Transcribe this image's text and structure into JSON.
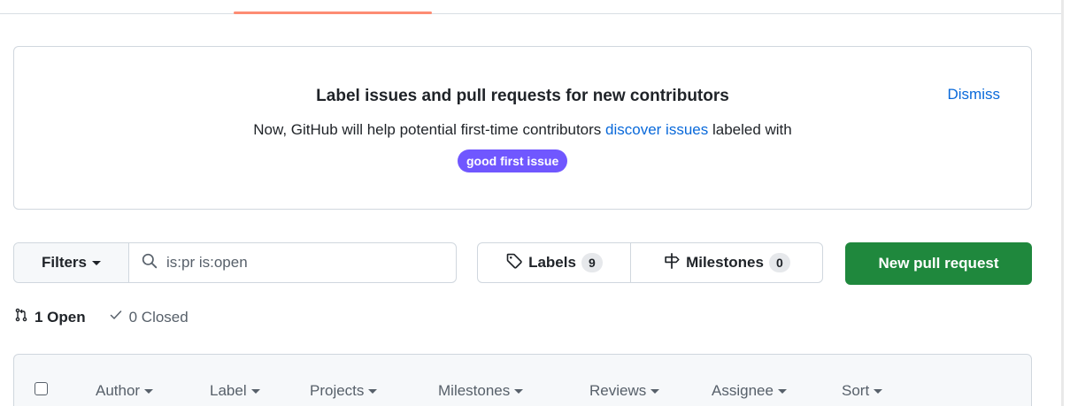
{
  "banner": {
    "title": "Label issues and pull requests for new contributors",
    "text_before": "Now, GitHub will help potential first-time contributors ",
    "link": "discover issues",
    "text_after": " labeled with",
    "label": "good first issue",
    "label_color": "#7057ff",
    "dismiss": "Dismiss"
  },
  "filters": {
    "button_label": "Filters",
    "search_value": "is:pr is:open"
  },
  "labels_button": {
    "label": "Labels",
    "count": "9"
  },
  "milestones_button": {
    "label": "Milestones",
    "count": "0"
  },
  "new_pr_button": {
    "label": "New pull request",
    "color": "#1f883d"
  },
  "states": {
    "open": "1 Open",
    "closed": "0 Closed"
  },
  "table_header": {
    "columns": [
      "Author",
      "Label",
      "Projects",
      "Milestones",
      "Reviews",
      "Assignee",
      "Sort"
    ]
  },
  "icons": {
    "search": "search-icon",
    "tag": "tag-icon",
    "milestone": "milestone-icon",
    "pull_request": "git-pull-request-icon",
    "check": "check-icon"
  },
  "colors": {
    "accent_link": "#0969da",
    "tab_underline": "#fd8c73",
    "border": "#d0d7de"
  }
}
